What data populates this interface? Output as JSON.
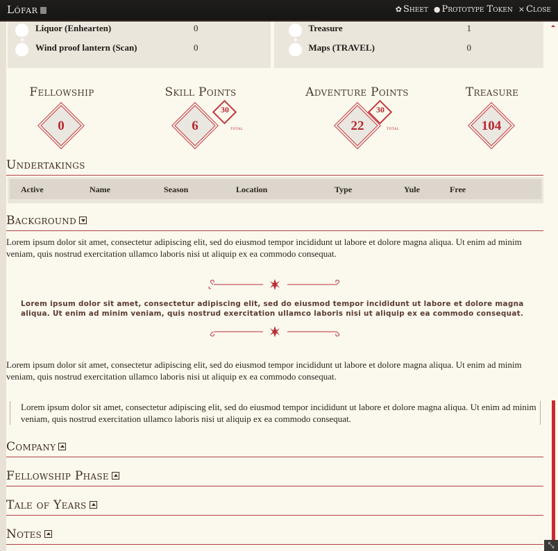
{
  "window": {
    "title": "Lófar",
    "controls": [
      {
        "icon": "gear-icon",
        "glyph": "✿",
        "label": "Sheet"
      },
      {
        "icon": "user-circle-icon",
        "glyph": "●",
        "label": "Prototype Token"
      },
      {
        "icon": "close-icon",
        "glyph": "×",
        "label": "Close"
      }
    ]
  },
  "inventory": {
    "left": [
      {
        "name": "Liquor (Enhearten)",
        "value": "0"
      },
      {
        "name": "Wind proof lantern (Scan)",
        "value": "0"
      }
    ],
    "right": [
      {
        "name": "Treasure",
        "value": "1"
      },
      {
        "name": "Maps (TRAVEL)",
        "value": "0"
      }
    ]
  },
  "stats": {
    "fellowship": {
      "label": "Fellowship",
      "value": "0"
    },
    "skill_points": {
      "label": "Skill Points",
      "value": "6",
      "total": "30",
      "total_label": "total"
    },
    "adventure_points": {
      "label": "Adventure Points",
      "value": "22",
      "total": "30",
      "total_label": "total"
    },
    "treasure": {
      "label": "Treasure",
      "value": "104"
    }
  },
  "undertakings": {
    "heading": "Undertakings",
    "columns": [
      "Active",
      "Name",
      "Season",
      "Location",
      "Type",
      "Yule",
      "Free"
    ]
  },
  "background": {
    "heading": "Background",
    "paragraph1": "Lorem ipsum dolor sit amet, consectetur adipiscing elit, sed do eiusmod tempor incididunt ut labore et dolore magna aliqua. Ut enim ad minim veniam, quis nostrud exercitation ullamco laboris nisi ut aliquip ex ea commodo consequat.",
    "centered": "Lorem ipsum dolor sit amet, consectetur adipiscing elit, sed do eiusmod tempor incididunt ut labore et dolore magna aliqua. Ut enim ad minim veniam, quis nostrud exercitation ullamco laboris nisi ut aliquip ex ea commodo consequat.",
    "paragraph2": "Lorem ipsum dolor sit amet, consectetur adipiscing elit, sed do eiusmod tempor incididunt ut labore et dolore magna aliqua. Ut enim ad minim veniam, quis nostrud exercitation ullamco laboris nisi ut aliquip ex ea commodo consequat.",
    "quote": "Lorem ipsum dolor sit amet, consectetur adipiscing elit, sed do eiusmod tempor incididunt ut labore et dolore magna aliqua. Ut enim ad minim veniam, quis nostrud exercitation ullamco laboris nisi ut aliquip ex ea commodo consequat."
  },
  "sections": [
    {
      "heading": "Company"
    },
    {
      "heading": "Fellowship Phase"
    },
    {
      "heading": "Tale of Years"
    },
    {
      "heading": "Notes"
    }
  ],
  "colors": {
    "accent": "#c2383c",
    "parchment": "#fbf8ee",
    "heading_text": "#3e2c1f"
  }
}
